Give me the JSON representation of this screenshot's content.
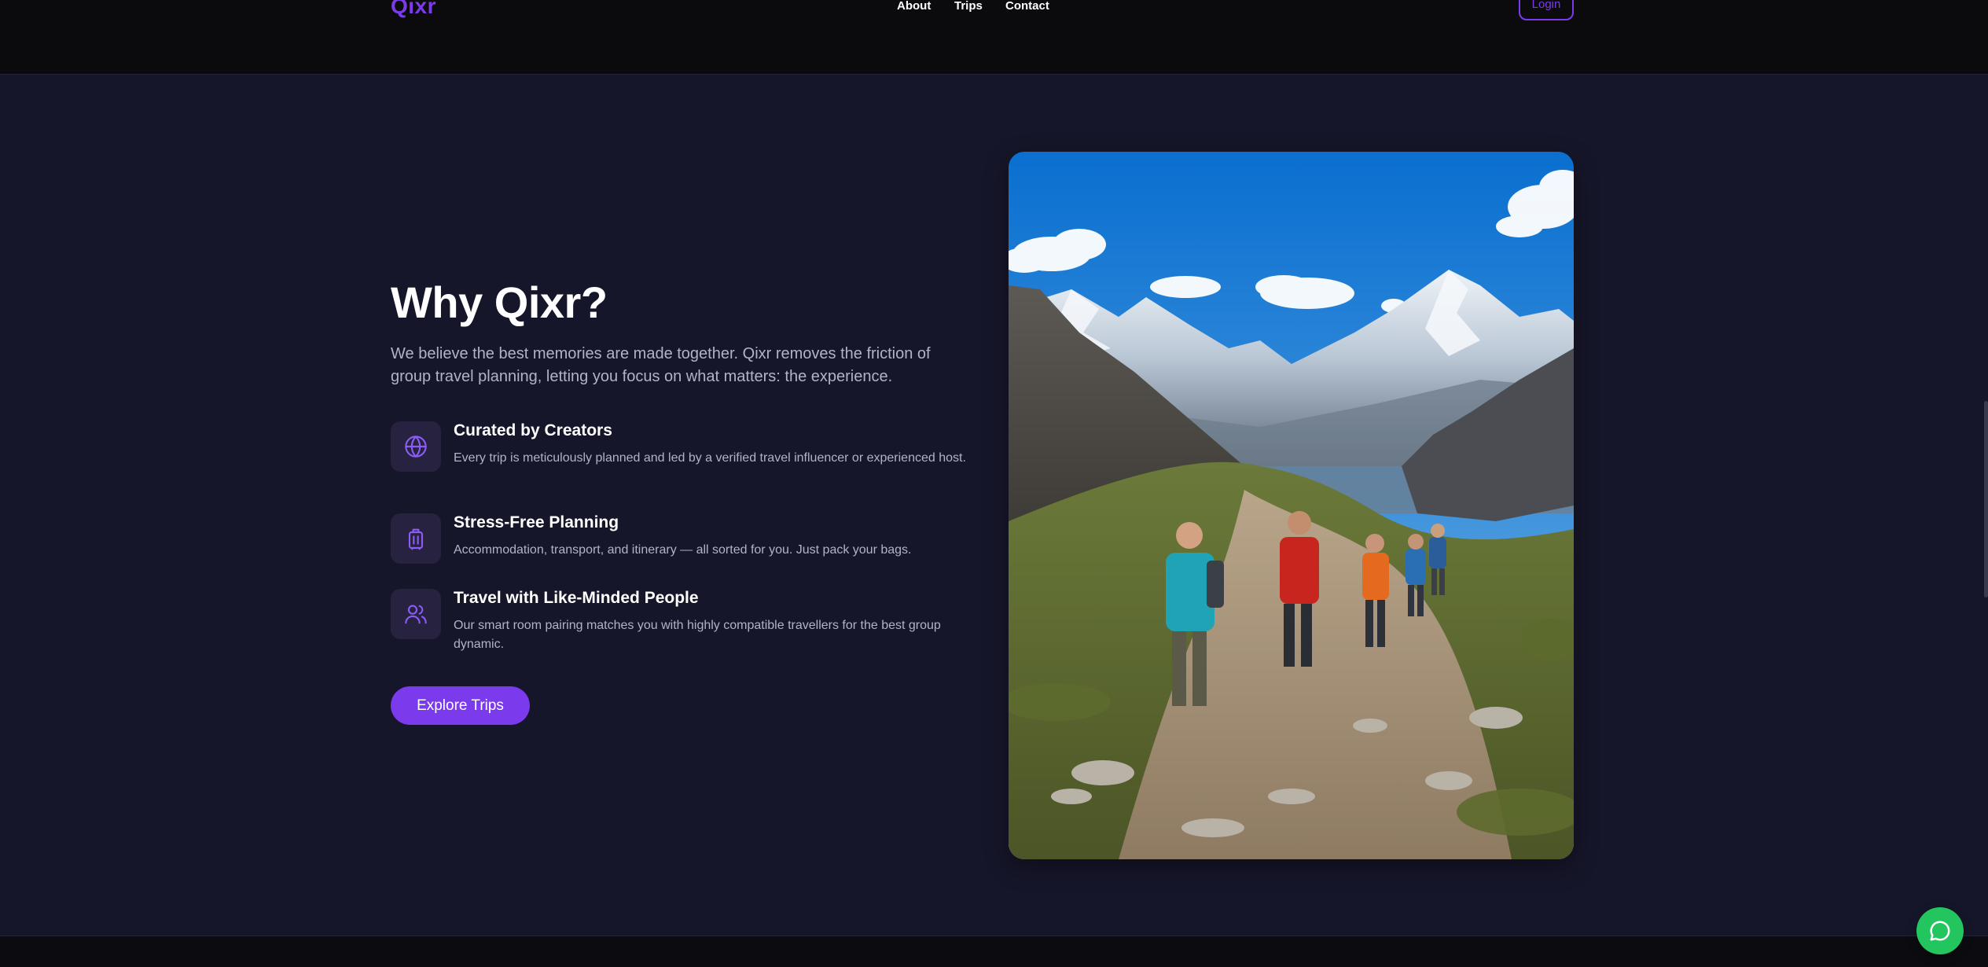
{
  "header": {
    "logo": "Qixr",
    "nav": [
      "About",
      "Trips",
      "Contact"
    ],
    "login_label": "Login"
  },
  "why": {
    "heading": "Why Qixr?",
    "intro": "We believe the best memories are made together. Qixr removes the friction of group travel planning, letting you focus on what matters: the experience.",
    "features": [
      {
        "icon": "globe-icon",
        "title": "Curated by Creators",
        "desc": "Every trip is meticulously planned and led by a verified travel influencer or experienced host."
      },
      {
        "icon": "luggage-icon",
        "title": "Stress-Free Planning",
        "desc": "Accommodation, transport, and itinerary — all sorted for you. Just pack your bags."
      },
      {
        "icon": "users-icon",
        "title": "Travel with Like-Minded People",
        "desc": "Our smart room pairing matches you with highly compatible travellers for the best group dynamic."
      }
    ],
    "cta_label": "Explore Trips"
  },
  "chat": {
    "icon": "chat-bubble-icon"
  },
  "colors": {
    "accent": "#7c3aed",
    "background": "#16162a",
    "header_bg": "#0b0b0d",
    "chat_green": "#22c55e"
  }
}
